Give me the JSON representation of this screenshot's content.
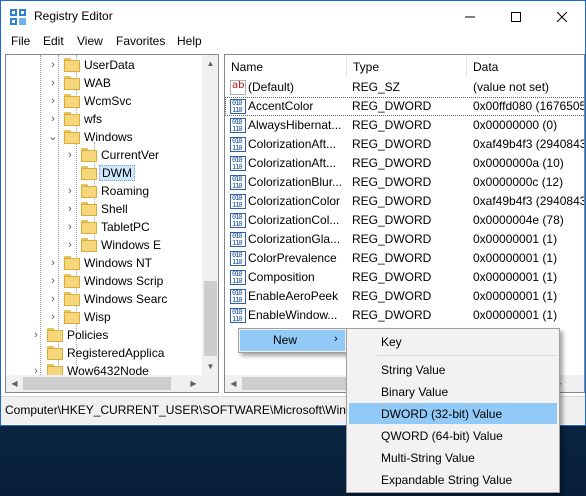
{
  "window": {
    "title": "Registry Editor"
  },
  "menu": [
    "File",
    "Edit",
    "View",
    "Favorites",
    "Help"
  ],
  "tree": [
    {
      "label": "UserData",
      "expandable": true,
      "selected": false
    },
    {
      "label": "WAB",
      "expandable": true,
      "selected": false
    },
    {
      "label": "WcmSvc",
      "expandable": true,
      "selected": false
    },
    {
      "label": "wfs",
      "expandable": true,
      "selected": false
    },
    {
      "label": "Windows",
      "expandable": true,
      "expanded": true,
      "selected": false
    },
    {
      "label": "CurrentVer",
      "expandable": true,
      "selected": false
    },
    {
      "label": "DWM",
      "expandable": false,
      "selected": true
    },
    {
      "label": "Roaming",
      "expandable": true,
      "selected": false
    },
    {
      "label": "Shell",
      "expandable": true,
      "selected": false
    },
    {
      "label": "TabletPC",
      "expandable": true,
      "selected": false
    },
    {
      "label": "Windows E",
      "expandable": true,
      "selected": false
    },
    {
      "label": "Windows NT",
      "expandable": true,
      "selected": false
    },
    {
      "label": "Windows Scrip",
      "expandable": true,
      "selected": false
    },
    {
      "label": "Windows Searc",
      "expandable": true,
      "selected": false
    },
    {
      "label": "Wisp",
      "expandable": true,
      "selected": false
    },
    {
      "label": "Policies",
      "expandable": true,
      "selected": false
    },
    {
      "label": "RegisteredApplica",
      "expandable": false,
      "selected": false
    },
    {
      "label": "Wow6432Node",
      "expandable": true,
      "selected": false
    }
  ],
  "columns": {
    "name": "Name",
    "type": "Type",
    "data": "Data"
  },
  "values": [
    {
      "name": "(Default)",
      "type": "REG_SZ",
      "data": "(value not set)",
      "icon": "string-value-icon"
    },
    {
      "name": "AccentColor",
      "type": "REG_DWORD",
      "data": "0x00ffd080 (16765056",
      "icon": "binary-value-icon"
    },
    {
      "name": "AlwaysHibernat...",
      "type": "REG_DWORD",
      "data": "0x00000000 (0)",
      "icon": "binary-value-icon"
    },
    {
      "name": "ColorizationAft...",
      "type": "REG_DWORD",
      "data": "0xaf49b4f3 (29408432",
      "icon": "binary-value-icon"
    },
    {
      "name": "ColorizationAft...",
      "type": "REG_DWORD",
      "data": "0x0000000a (10)",
      "icon": "binary-value-icon"
    },
    {
      "name": "ColorizationBlur...",
      "type": "REG_DWORD",
      "data": "0x0000000c (12)",
      "icon": "binary-value-icon"
    },
    {
      "name": "ColorizationColor",
      "type": "REG_DWORD",
      "data": "0xaf49b4f3 (29408432",
      "icon": "binary-value-icon"
    },
    {
      "name": "ColorizationCol...",
      "type": "REG_DWORD",
      "data": "0x0000004e (78)",
      "icon": "binary-value-icon"
    },
    {
      "name": "ColorizationGla...",
      "type": "REG_DWORD",
      "data": "0x00000001 (1)",
      "icon": "binary-value-icon"
    },
    {
      "name": "ColorPrevalence",
      "type": "REG_DWORD",
      "data": "0x00000001 (1)",
      "icon": "binary-value-icon"
    },
    {
      "name": "Composition",
      "type": "REG_DWORD",
      "data": "0x00000001 (1)",
      "icon": "binary-value-icon"
    },
    {
      "name": "EnableAeroPeek",
      "type": "REG_DWORD",
      "data": "0x00000001 (1)",
      "icon": "binary-value-icon"
    },
    {
      "name": "EnableWindow...",
      "type": "REG_DWORD",
      "data": "0x00000001 (1)",
      "icon": "binary-value-icon"
    }
  ],
  "status": {
    "path": "Computer\\HKEY_CURRENT_USER\\SOFTWARE\\Microsoft\\Window"
  },
  "context_menu": {
    "new_label": "New",
    "arrow": "›"
  },
  "submenu": [
    {
      "label": "Key",
      "hover": false
    },
    {
      "label": "String Value",
      "hover": false
    },
    {
      "label": "Binary Value",
      "hover": false
    },
    {
      "label": "DWORD (32-bit) Value",
      "hover": true
    },
    {
      "label": "QWORD (64-bit) Value",
      "hover": false
    },
    {
      "label": "Multi-String Value",
      "hover": false
    },
    {
      "label": "Expandable String Value",
      "hover": false
    }
  ],
  "colors": {
    "accent": "#0078d7",
    "selection": "#cce8ff",
    "menu_hover": "#91c9f7",
    "desktop": "#0b3766"
  }
}
